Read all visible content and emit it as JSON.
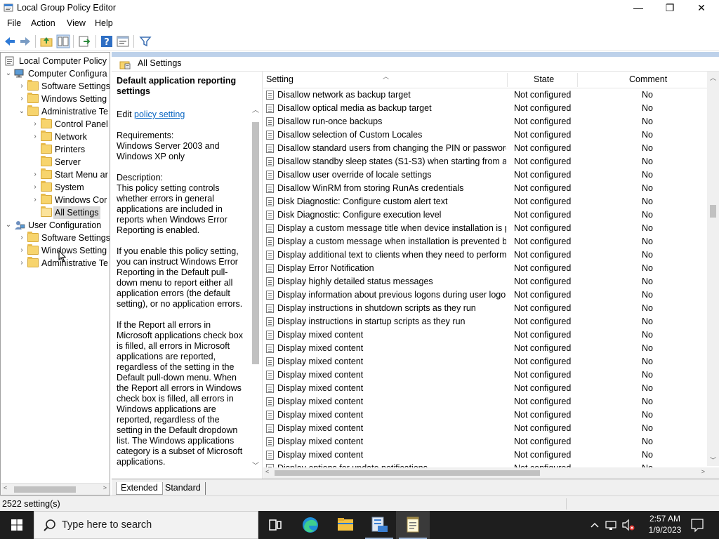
{
  "window": {
    "title": "Local Group Policy Editor",
    "minimize_glyph": "—",
    "maximize_glyph": "❐",
    "close_glyph": "✕"
  },
  "menu": [
    "File",
    "Action",
    "View",
    "Help"
  ],
  "tree": [
    {
      "label": "Local Computer Policy",
      "expander": "",
      "icon": "computer"
    },
    {
      "label": "Computer Configura",
      "expander": "⌄",
      "icon": "computer"
    },
    {
      "label": "Software Settings",
      "expander": "›",
      "icon": "folder"
    },
    {
      "label": "Windows Setting",
      "expander": "›",
      "icon": "folder"
    },
    {
      "label": "Administrative Te",
      "expander": "⌄",
      "icon": "folder"
    },
    {
      "label": "Control Panel",
      "expander": "›",
      "icon": "folder"
    },
    {
      "label": "Network",
      "expander": "›",
      "icon": "folder"
    },
    {
      "label": "Printers",
      "expander": "",
      "icon": "folder"
    },
    {
      "label": "Server",
      "expander": "",
      "icon": "folder"
    },
    {
      "label": "Start Menu ar",
      "expander": "›",
      "icon": "folder"
    },
    {
      "label": "System",
      "expander": "›",
      "icon": "folder"
    },
    {
      "label": "Windows Cor",
      "expander": "›",
      "icon": "folder"
    },
    {
      "label": "All Settings",
      "expander": "",
      "icon": "folder-open"
    },
    {
      "label": "User Configuration",
      "expander": "⌄",
      "icon": "user"
    },
    {
      "label": "Software Settings",
      "expander": "›",
      "icon": "folder"
    },
    {
      "label": "Windows Setting",
      "expander": "›",
      "icon": "folder"
    },
    {
      "label": "Administrative Te",
      "expander": "›",
      "icon": "folder"
    }
  ],
  "content": {
    "header_title": "All Settings",
    "description": {
      "title": "Default application reporting settings",
      "edit_prefix": "Edit ",
      "edit_link": "policy setting ",
      "body": "Requirements:\nWindows Server 2003 and Windows XP only\n\nDescription:\nThis policy setting controls whether errors in general applications are included in reports when Windows Error Reporting is enabled.\n\nIf you enable this policy setting, you can instruct Windows Error Reporting in the Default pull-down menu to report either all application errors (the default setting), or no application errors.\n\nIf the Report all errors in Microsoft applications check box is filled, all errors in Microsoft applications are reported, regardless of the setting in the Default pull-down menu. When the Report all errors in Windows check box is filled, all errors in Windows applications are reported, regardless of the setting in the Default dropdown list. The Windows applications category is a subset of Microsoft applications.\n\nIf you disable or do not configure this policy setting, users can"
    },
    "columns": {
      "setting": "Setting",
      "state": "State",
      "comment": "Comment"
    },
    "rows": [
      {
        "name": "Disallow network as backup target",
        "state": "Not configured",
        "comment": "No"
      },
      {
        "name": "Disallow optical media as backup target",
        "state": "Not configured",
        "comment": "No"
      },
      {
        "name": "Disallow run-once backups",
        "state": "Not configured",
        "comment": "No"
      },
      {
        "name": "Disallow selection of Custom Locales",
        "state": "Not configured",
        "comment": "No"
      },
      {
        "name": "Disallow standard users from changing the PIN or password",
        "state": "Not configured",
        "comment": "No"
      },
      {
        "name": "Disallow standby sleep states (S1-S3) when starting from a ...",
        "state": "Not configured",
        "comment": "No"
      },
      {
        "name": "Disallow user override of locale settings",
        "state": "Not configured",
        "comment": "No"
      },
      {
        "name": "Disallow WinRM from storing RunAs credentials",
        "state": "Not configured",
        "comment": "No"
      },
      {
        "name": "Disk Diagnostic: Configure custom alert text",
        "state": "Not configured",
        "comment": "No"
      },
      {
        "name": "Disk Diagnostic: Configure execution level",
        "state": "Not configured",
        "comment": "No"
      },
      {
        "name": "Display a custom message title when device installation is pr...",
        "state": "Not configured",
        "comment": "No"
      },
      {
        "name": "Display a custom message when installation is prevented by...",
        "state": "Not configured",
        "comment": "No"
      },
      {
        "name": "Display additional text to clients when they need to perform...",
        "state": "Not configured",
        "comment": "No"
      },
      {
        "name": "Display Error Notification",
        "state": "Not configured",
        "comment": "No"
      },
      {
        "name": "Display highly detailed status messages",
        "state": "Not configured",
        "comment": "No"
      },
      {
        "name": "Display information about previous logons during user logon",
        "state": "Not configured",
        "comment": "No"
      },
      {
        "name": "Display instructions in shutdown scripts as they run",
        "state": "Not configured",
        "comment": "No"
      },
      {
        "name": "Display instructions in startup scripts as they run",
        "state": "Not configured",
        "comment": "No"
      },
      {
        "name": "Display mixed content",
        "state": "Not configured",
        "comment": "No"
      },
      {
        "name": "Display mixed content",
        "state": "Not configured",
        "comment": "No"
      },
      {
        "name": "Display mixed content",
        "state": "Not configured",
        "comment": "No"
      },
      {
        "name": "Display mixed content",
        "state": "Not configured",
        "comment": "No"
      },
      {
        "name": "Display mixed content",
        "state": "Not configured",
        "comment": "No"
      },
      {
        "name": "Display mixed content",
        "state": "Not configured",
        "comment": "No"
      },
      {
        "name": "Display mixed content",
        "state": "Not configured",
        "comment": "No"
      },
      {
        "name": "Display mixed content",
        "state": "Not configured",
        "comment": "No"
      },
      {
        "name": "Display mixed content",
        "state": "Not configured",
        "comment": "No"
      },
      {
        "name": "Display mixed content",
        "state": "Not configured",
        "comment": "No"
      },
      {
        "name": "Display options for update notifications",
        "state": "Not configured",
        "comment": "No"
      }
    ],
    "tabs": [
      "Extended",
      "Standard"
    ]
  },
  "status": {
    "text": "2522 setting(s)"
  },
  "taskbar": {
    "search_placeholder": "Type here to search",
    "apps": [
      "task-view",
      "edge",
      "file-explorer",
      "server-manager",
      "notepad"
    ],
    "time": "2:57 AM",
    "date": "1/9/2023"
  },
  "colors": {
    "accent": "#0563c1",
    "header_band": "#bdd1ea",
    "taskbar": "#1e1e1e"
  }
}
